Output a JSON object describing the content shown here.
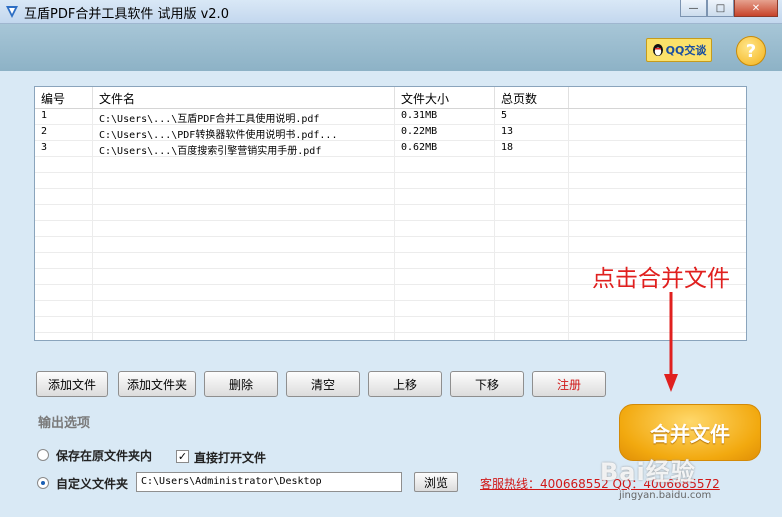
{
  "window": {
    "title": "互盾PDF合并工具软件 试用版 v2.0",
    "minimize_glyph": "—",
    "maximize_glyph": "□",
    "close_glyph": "✕"
  },
  "header": {
    "qq_button_label": "QQ交谈",
    "help_glyph": "?"
  },
  "table": {
    "columns": [
      "编号",
      "文件名",
      "文件大小",
      "总页数"
    ],
    "rows": [
      {
        "num": "1",
        "name": "C:\\Users\\...\\互盾PDF合并工具使用说明.pdf",
        "size": "0.31MB",
        "pages": "5"
      },
      {
        "num": "2",
        "name": "C:\\Users\\...\\PDF转换器软件使用说明书.pdf...",
        "size": "0.22MB",
        "pages": "13"
      },
      {
        "num": "3",
        "name": "C:\\Users\\...\\百度搜索引擎营销实用手册.pdf",
        "size": "0.62MB",
        "pages": "18"
      }
    ]
  },
  "toolbar": {
    "add_file": "添加文件",
    "add_folder": "添加文件夹",
    "delete": "删除",
    "clear": "清空",
    "move_up": "上移",
    "move_down": "下移",
    "register": "注册"
  },
  "output": {
    "section_title": "输出选项",
    "save_original": "保存在原文件夹内",
    "open_directly": "直接打开文件",
    "custom_folder": "自定义文件夹",
    "custom_path": "C:\\Users\\Administrator\\Desktop",
    "browse": "浏览",
    "hotline": "客服热线：400668552 QQ：4006685572"
  },
  "merge_button_label": "合并文件",
  "annotation_text": "点击合并文件",
  "watermark": {
    "text": "Bai经验",
    "sub": "jingyan.baidu.com"
  },
  "colors": {
    "header_strip": "#9dbfd2",
    "panel_bg": "#d9e9f5",
    "merge_button": "#f2a90f",
    "annotation": "#e0201f",
    "register_text": "#d01818"
  }
}
